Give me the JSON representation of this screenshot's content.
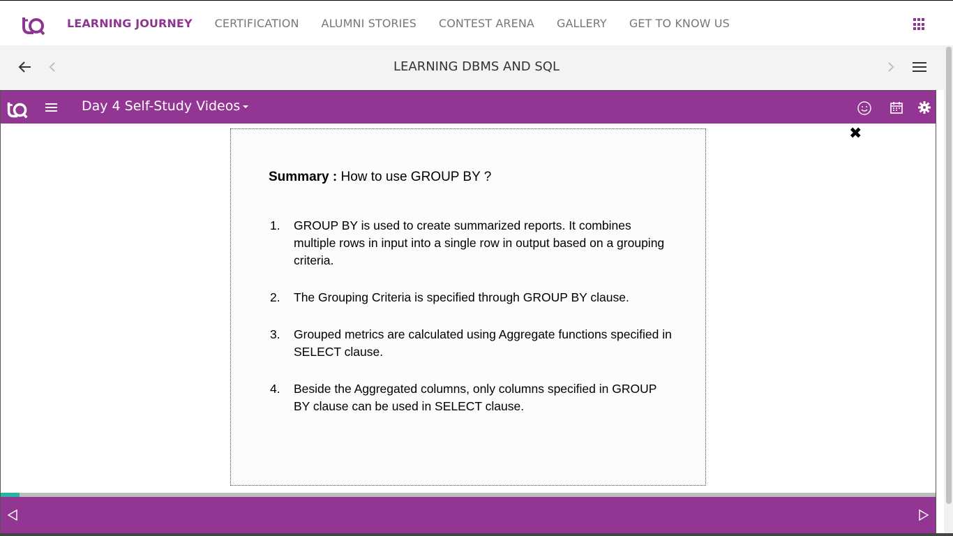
{
  "nav": {
    "items": [
      {
        "label": "LEARNING JOURNEY",
        "active": true
      },
      {
        "label": "CERTIFICATION",
        "active": false
      },
      {
        "label": "ALUMNI STORIES",
        "active": false
      },
      {
        "label": "CONTEST ARENA",
        "active": false
      },
      {
        "label": "GALLERY",
        "active": false
      },
      {
        "label": "GET TO KNOW US",
        "active": false
      }
    ],
    "apps_icon": "apps-grid-icon"
  },
  "course": {
    "title": "LEARNING DBMS AND SQL"
  },
  "player": {
    "module_title": "Day 4 Self-Study Videos",
    "close_glyph": "✖",
    "progress": 0.02
  },
  "slide": {
    "heading_label": "Summary :",
    "heading_text": " How to use GROUP BY ?",
    "points": [
      {
        "num": "1.",
        "text": "GROUP BY is used to create summarized reports. It combines multiple rows in input into a single row in output based on a grouping criteria."
      },
      {
        "num": "2.",
        "text": "The Grouping Criteria is specified through GROUP BY clause."
      },
      {
        "num": "3.",
        "text": "Grouped metrics are calculated using Aggregate functions specified in SELECT clause."
      },
      {
        "num": "4.",
        "text": "Beside the Aggregated columns, only columns specified in GROUP BY clause can be used in SELECT clause."
      }
    ]
  },
  "colors": {
    "brand": "#933592",
    "accent": "#2bb3a5"
  }
}
